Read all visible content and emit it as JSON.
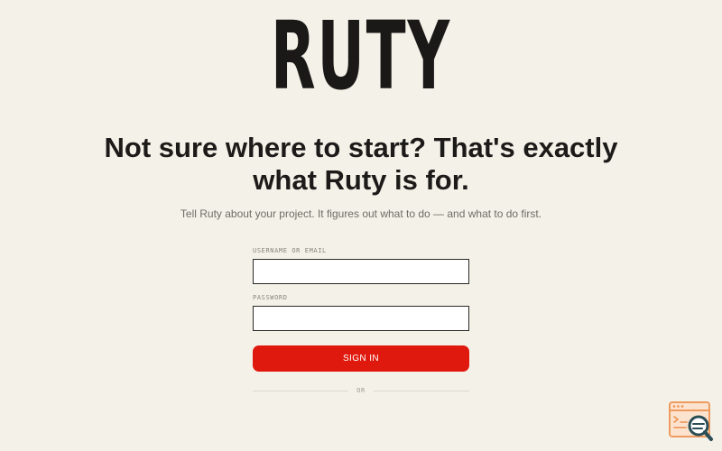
{
  "brand": {
    "logo_text": "RUTY"
  },
  "hero": {
    "headline_line1": "Not sure where to start? That's exactly",
    "headline_line2": "what Ruty is for.",
    "subtitle": "Tell Ruty about your project. It figures out what to do — and what to do first."
  },
  "login_form": {
    "username_label": "USERNAME OR EMAIL",
    "username_value": "",
    "password_label": "PASSWORD",
    "password_value": "",
    "sign_in_label": "SIGN IN",
    "divider_text": "OR"
  },
  "colors": {
    "background": "#f4f1e8",
    "accent": "#e0190e",
    "text": "#1c1b19"
  },
  "icons": {
    "corner_badge": "browser-search-icon"
  }
}
